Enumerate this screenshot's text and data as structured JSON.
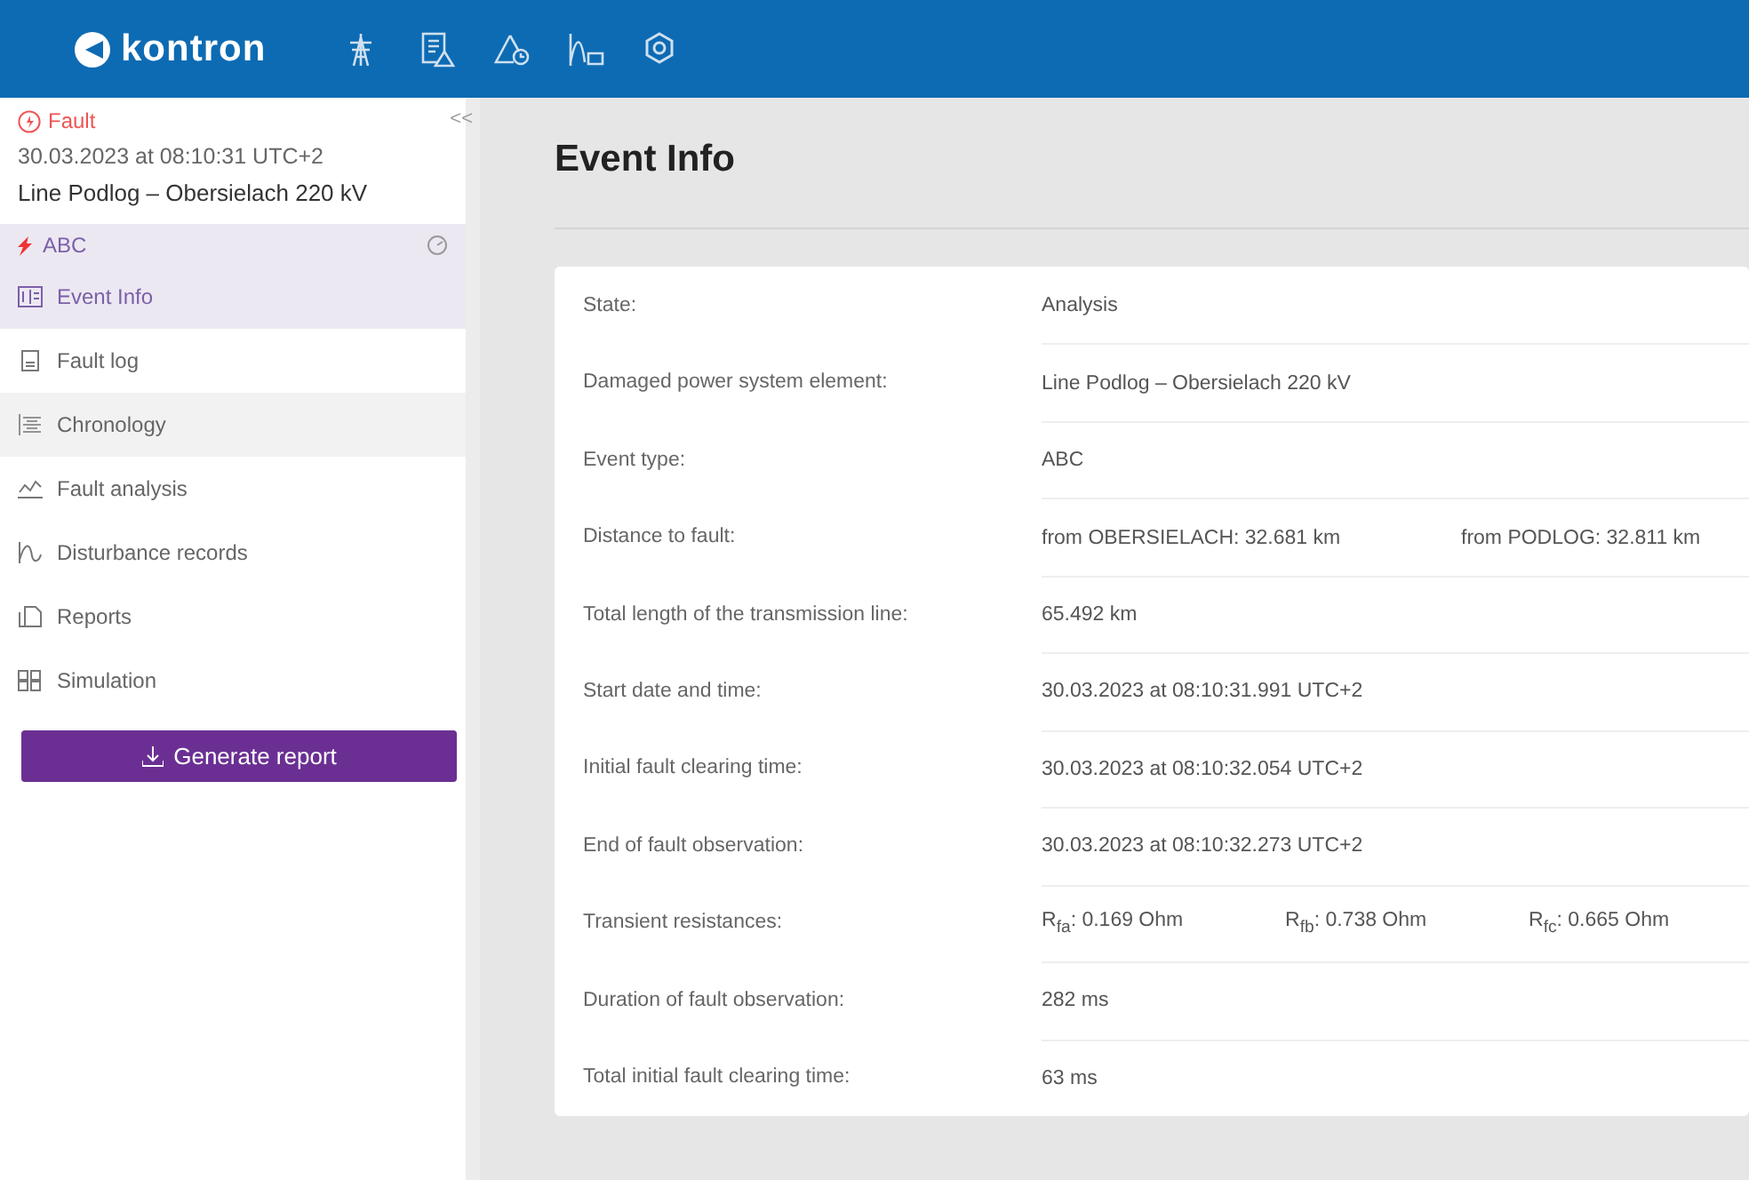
{
  "header": {
    "logo": "kontron"
  },
  "sidebar": {
    "collapse": "<<",
    "event": {
      "status": "Fault",
      "datetime": "30.03.2023 at 08:10:31 UTC+2",
      "element": "Line Podlog – Obersielach 220 kV",
      "type": "ABC"
    },
    "items": [
      {
        "label": "Event Info",
        "selected": true,
        "highlighted": false
      },
      {
        "label": "Fault log",
        "selected": false,
        "highlighted": false
      },
      {
        "label": "Chronology",
        "selected": false,
        "highlighted": true
      },
      {
        "label": "Fault analysis",
        "selected": false,
        "highlighted": false
      },
      {
        "label": "Disturbance records",
        "selected": false,
        "highlighted": false
      },
      {
        "label": "Reports",
        "selected": false,
        "highlighted": false
      },
      {
        "label": "Simulation",
        "selected": false,
        "highlighted": false
      }
    ],
    "button": "Generate report"
  },
  "main": {
    "title": "Event Info",
    "rows": [
      {
        "label": "State:",
        "values": [
          "Analysis"
        ]
      },
      {
        "label": "Damaged power system element:",
        "values": [
          "Line Podlog – Obersielach 220 kV"
        ]
      },
      {
        "label": "Event type:",
        "values": [
          "ABC"
        ]
      },
      {
        "label": "Distance to fault:",
        "values": [
          "from OBERSIELACH: 32.681 km",
          "from PODLOG: 32.811 km"
        ]
      },
      {
        "label": "Total length of the transmission line:",
        "values": [
          "65.492 km"
        ]
      },
      {
        "label": "Start date and time:",
        "values": [
          "30.03.2023 at 08:10:31.991 UTC+2"
        ]
      },
      {
        "label": "Initial fault clearing time:",
        "values": [
          "30.03.2023 at 08:10:32.054 UTC+2"
        ]
      },
      {
        "label": "End of fault observation:",
        "values": [
          "30.03.2023 at 08:10:32.273 UTC+2"
        ]
      },
      {
        "label": "Transient resistances:",
        "values": [
          "R$_{fa}$: 0.169 Ohm",
          "R$_{fb}$: 0.738 Ohm",
          "R$_{fc}$: 0.665 Ohm"
        ]
      },
      {
        "label": "Duration of fault observation:",
        "values": [
          "282 ms"
        ]
      },
      {
        "label": "Total initial fault clearing time:",
        "values": [
          "63 ms"
        ]
      }
    ]
  }
}
